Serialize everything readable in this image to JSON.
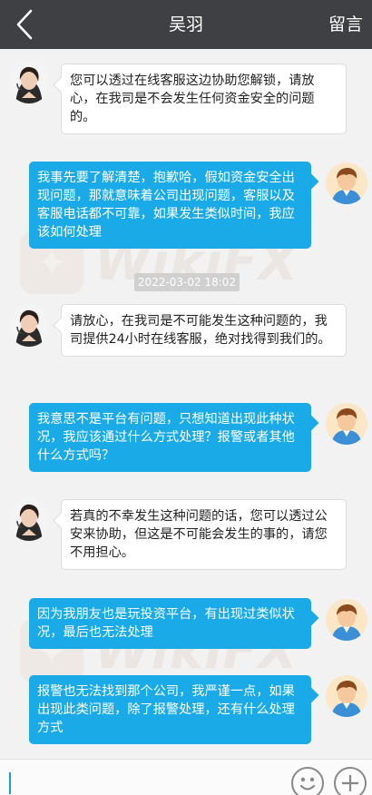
{
  "header": {
    "title": "吴羽",
    "right_action": "留言"
  },
  "watermark": "WikiFX",
  "messages": [
    {
      "side": "agent",
      "text": "您可以透过在线客服这边协助您解锁，请放心，在我司是不会发生任何资金安全的问题的。"
    },
    {
      "side": "user",
      "text": "我事先要了解清楚，抱歉哈，假如资金安全出现问题，那就意味着公司出现问题，客服以及客服电话都不可靠，如果发生类似时间，我应该如何处理"
    },
    {
      "side": "timestamp",
      "text": "2022-03-02 18:02"
    },
    {
      "side": "agent",
      "text": "请放心，在我司是不可能发生这种问题的，我司提供24小时在线客服，绝对找得到我们的。"
    },
    {
      "side": "user",
      "text": "我意思不是平台有问题，只想知道出现此种状况，我应该通过什么方式处理？报警或者其他什么方式吗？"
    },
    {
      "side": "agent",
      "text": "若真的不幸发生这种问题的话，您可以透过公安来协助，但这是不可能会发生的事的，请您不用担心。"
    },
    {
      "side": "user",
      "text": "因为我朋友也是玩投资平台，有出现过类似状况，最后也无法处理"
    },
    {
      "side": "user",
      "text": "报警也无法找到那个公司，我严谨一点，如果出现此类问题，除了报警处理，还有什么处理方式"
    }
  ],
  "colors": {
    "header_bg": "#3f4043",
    "user_bubble": "#1aaae8",
    "agent_bubble": "#ffffff",
    "background": "#f2f2f2"
  }
}
